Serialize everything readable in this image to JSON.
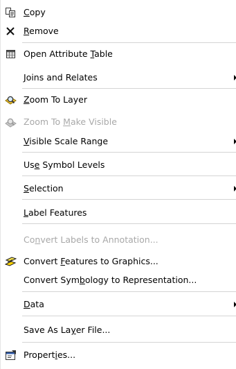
{
  "menu": {
    "items": [
      {
        "name": "copy",
        "parts": [
          "",
          "C",
          "opy"
        ],
        "enabled": true,
        "submenu": false,
        "icon": "copy-icon"
      },
      {
        "name": "remove",
        "parts": [
          "",
          "R",
          "emove"
        ],
        "enabled": true,
        "submenu": false,
        "icon": "remove-x-icon"
      },
      {
        "name": "open-attribute-table",
        "parts": [
          "Open Attribute ",
          "T",
          "able"
        ],
        "enabled": true,
        "submenu": false,
        "icon": "table-icon"
      },
      {
        "name": "joins-and-relates",
        "parts": [
          "",
          "J",
          "oins and Relates"
        ],
        "enabled": true,
        "submenu": true,
        "icon": ""
      },
      {
        "name": "zoom-to-layer",
        "parts": [
          "",
          "Z",
          "oom To Layer"
        ],
        "enabled": true,
        "submenu": false,
        "icon": "zoom-to-layer-icon"
      },
      {
        "name": "zoom-to-make-visible",
        "parts": [
          "Zoom To ",
          "M",
          "ake Visible"
        ],
        "enabled": false,
        "submenu": false,
        "icon": "zoom-to-make-visible-icon"
      },
      {
        "name": "visible-scale-range",
        "parts": [
          "",
          "V",
          "isible Scale Range"
        ],
        "enabled": true,
        "submenu": true,
        "icon": ""
      },
      {
        "name": "use-symbol-levels",
        "parts": [
          "Us",
          "e",
          " Symbol Levels"
        ],
        "enabled": true,
        "submenu": false,
        "icon": ""
      },
      {
        "name": "selection",
        "parts": [
          "",
          "S",
          "election"
        ],
        "enabled": true,
        "submenu": true,
        "icon": ""
      },
      {
        "name": "label-features",
        "parts": [
          "",
          "L",
          "abel Features"
        ],
        "enabled": true,
        "submenu": false,
        "icon": ""
      },
      {
        "name": "convert-labels-to-annotation",
        "parts": [
          "Co",
          "n",
          "vert Labels to Annotation..."
        ],
        "enabled": false,
        "submenu": false,
        "icon": ""
      },
      {
        "name": "convert-features-to-graphics",
        "parts": [
          "Convert ",
          "F",
          "eatures to Graphics..."
        ],
        "enabled": true,
        "submenu": false,
        "icon": "convert-features-icon"
      },
      {
        "name": "convert-symbology-to-representation",
        "parts": [
          "Convert Sym",
          "b",
          "ology to Representation..."
        ],
        "enabled": true,
        "submenu": false,
        "icon": ""
      },
      {
        "name": "data",
        "parts": [
          "",
          "D",
          "ata"
        ],
        "enabled": true,
        "submenu": true,
        "icon": ""
      },
      {
        "name": "save-as-layer-file",
        "parts": [
          "Save As La",
          "y",
          "er File..."
        ],
        "enabled": true,
        "submenu": false,
        "icon": ""
      },
      {
        "name": "properties",
        "parts": [
          "Propert",
          "i",
          "es..."
        ],
        "enabled": true,
        "submenu": false,
        "icon": "properties-icon"
      }
    ]
  }
}
